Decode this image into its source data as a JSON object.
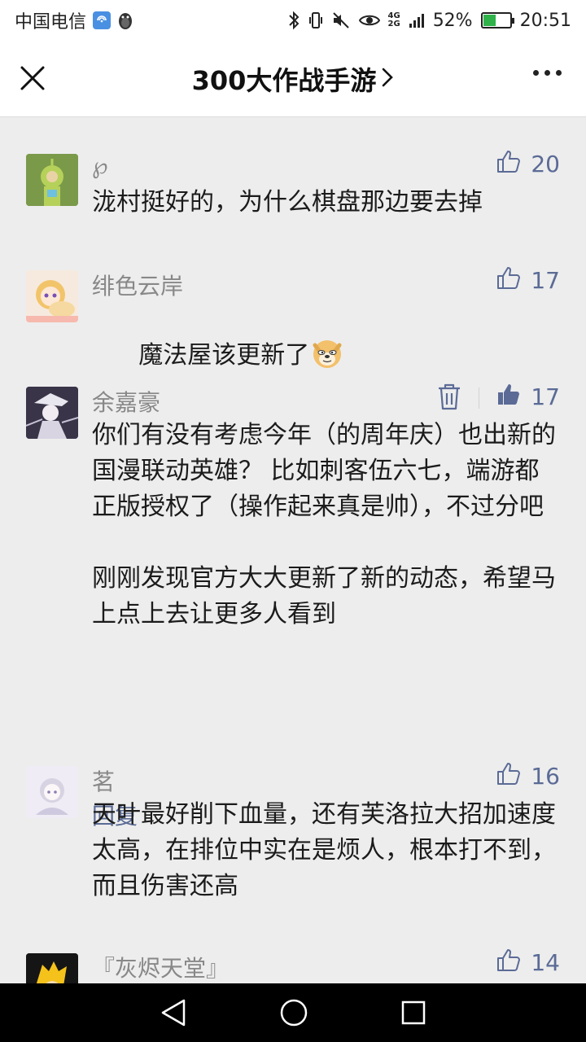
{
  "status_bar": {
    "carrier": "中国电信",
    "network_top": "4G",
    "network_bottom": "2G",
    "battery_percent": "52%",
    "battery_level": 0.52,
    "time": "20:51"
  },
  "nav": {
    "title": "300大作战手游",
    "title_chevron": "›"
  },
  "comments": [
    {
      "name": "℘",
      "likes": "20",
      "liked": false,
      "text": "泷村挺好的，为什么棋盘那边要去掉",
      "avatar": "teletubby-avatar"
    },
    {
      "name": "绯色云岸",
      "likes": "17",
      "liked": false,
      "text": "魔法屋该更新了",
      "avatar": "anime-girl-avatar",
      "emoji": "doge-emoji"
    },
    {
      "name": "余嘉豪",
      "likes": "17",
      "liked": true,
      "text": "你们有没有考虑今年（的周年庆）也出新的国漫联动英雄？ 比如刺客伍六七，端游都正版授权了（操作起来真是帅），不过分吧\n\n刚刚发现官方大大更新了新的动态，希望马上点上去让更多人看到",
      "reply_label": "回复",
      "avatar": "manga-character-avatar"
    },
    {
      "name": "茗",
      "likes": "16",
      "liked": false,
      "text": "天叶最好削下血量，还有芙洛拉大招加速度太高，在排位中实在是烦人，根本打不到，而且伤害还高",
      "avatar": "chibi-girl-avatar"
    },
    {
      "name": "『灰烬天堂』",
      "likes": "14",
      "liked": false,
      "text": "",
      "avatar": "blonde-character-avatar"
    }
  ],
  "colors": {
    "like_blue": "#5b6b96",
    "background": "#ededed",
    "nickname_gray": "#888888"
  }
}
